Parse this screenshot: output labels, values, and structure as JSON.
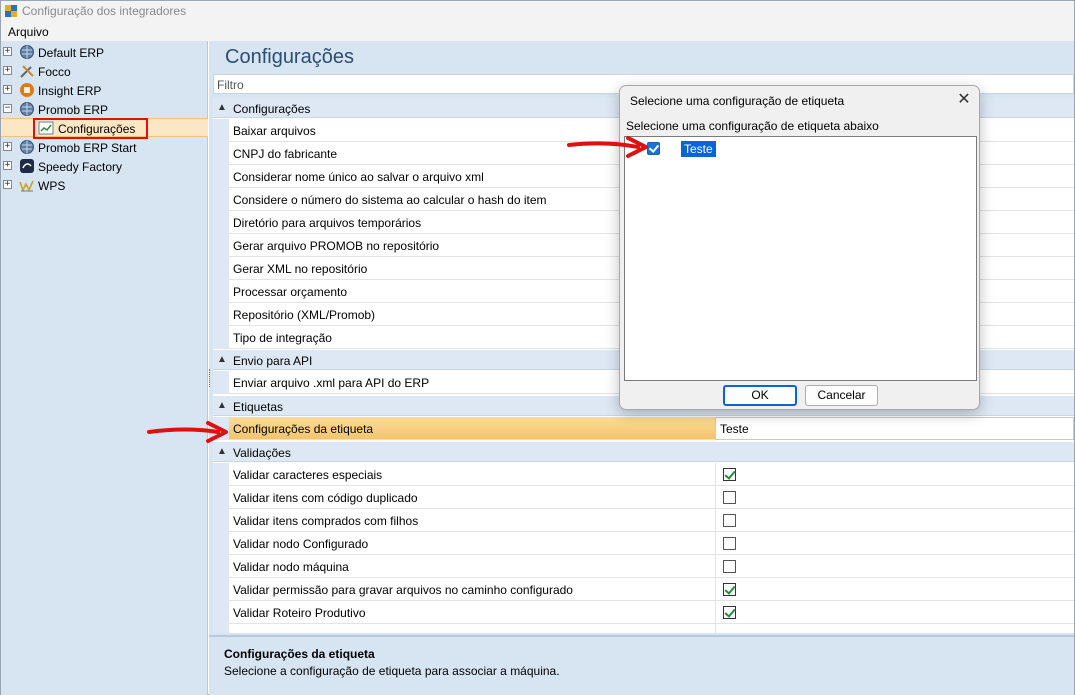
{
  "window": {
    "title": "Configuração dos integradores"
  },
  "menu": {
    "items": [
      "Arquivo"
    ]
  },
  "tree": {
    "nodes": [
      {
        "label": "Default ERP",
        "icon": "globe-icon",
        "expander": "+"
      },
      {
        "label": "Focco",
        "icon": "tools-icon",
        "expander": "+"
      },
      {
        "label": "Insight ERP",
        "icon": "insight-icon",
        "expander": "+"
      },
      {
        "label": "Promob ERP",
        "icon": "globe-icon",
        "expander": "−"
      },
      {
        "label": "Configurações",
        "icon": "chart-icon",
        "expander": ""
      },
      {
        "label": "Promob ERP Start",
        "icon": "globe-icon",
        "expander": "+"
      },
      {
        "label": "Speedy Factory",
        "icon": "speedy-icon",
        "expander": "+"
      },
      {
        "label": "WPS",
        "icon": "wps-icon",
        "expander": "+"
      }
    ]
  },
  "main": {
    "title": "Configurações",
    "filter_placeholder": "Filtro",
    "categories": {
      "config": "Configurações",
      "api": "Envio para API",
      "etiquetas": "Etiquetas",
      "validacoes": "Validações"
    },
    "config_props": [
      "Baixar arquivos",
      "CNPJ do fabricante",
      "Considerar nome único ao salvar o arquivo xml",
      "Considere o número do sistema ao calcular o hash do item",
      "Diretório para arquivos temporários",
      "Gerar arquivo PROMOB no repositório",
      "Gerar XML no repositório",
      "Processar orçamento",
      "Repositório (XML/Promob)",
      "Tipo de integração"
    ],
    "api_props": [
      "Enviar arquivo .xml para API do ERP"
    ],
    "etiqueta_prop": {
      "name": "Configurações da etiqueta",
      "value": "Teste"
    },
    "validacoes": [
      {
        "name": "Validar caracteres especiais",
        "checked": true
      },
      {
        "name": "Validar itens com código duplicado",
        "checked": false
      },
      {
        "name": "Validar itens comprados com filhos",
        "checked": false
      },
      {
        "name": "Validar nodo Configurado",
        "checked": false
      },
      {
        "name": "Validar nodo máquina",
        "checked": false
      },
      {
        "name": "Validar permissão para gravar arquivos no caminho configurado",
        "checked": true
      },
      {
        "name": "Validar Roteiro Produtivo",
        "checked": true
      }
    ],
    "description": {
      "title": "Configurações da etiqueta",
      "text": "Selecione a configuração de etiqueta para associar a máquina."
    }
  },
  "dialog": {
    "title": "Selecione uma configuração de etiqueta",
    "label": "Selecione uma configuração de etiqueta abaixo",
    "items": [
      {
        "label": "Teste",
        "checked": true
      }
    ],
    "ok_label": "OK",
    "cancel_label": "Cancelar"
  },
  "colors": {
    "annotation_red": "#e01010",
    "accent_blue": "#0a64d6",
    "panel_bg": "#d7e4f2"
  }
}
